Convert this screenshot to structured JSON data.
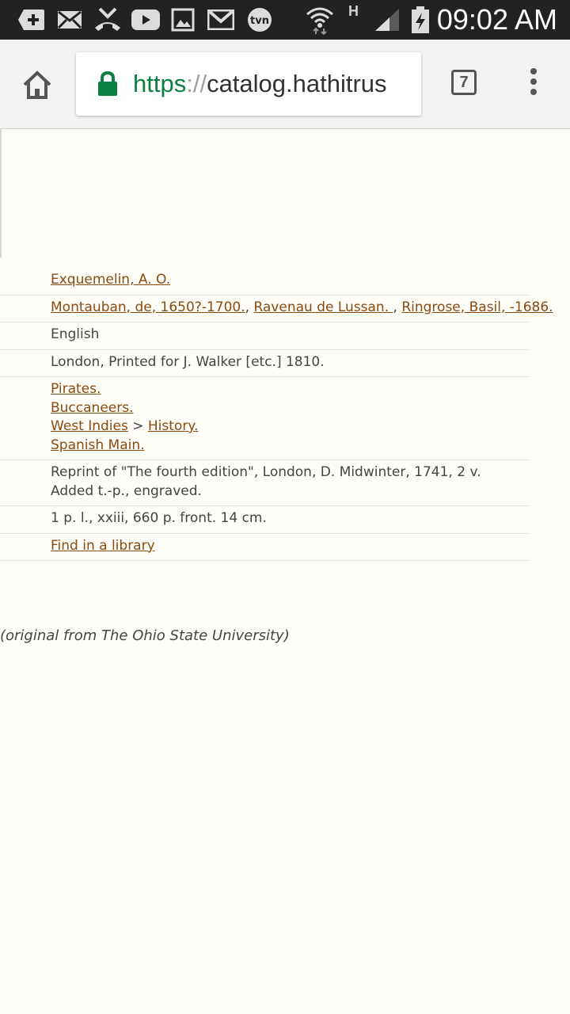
{
  "status_bar": {
    "time": "09:02 AM",
    "network_type": "H",
    "left_icons": [
      "add-icon",
      "mail-icon",
      "missed-call-icon",
      "youtube-icon",
      "gallery-icon",
      "gmail-icon",
      "tvn-icon"
    ],
    "tvn_label": "tvn",
    "right_icons": [
      "wifi-icon",
      "signal-icon",
      "battery-charging-icon"
    ]
  },
  "browser": {
    "url_scheme": "https",
    "url_sep": "://",
    "url_host": "catalog.hathitrus",
    "tab_count": "7"
  },
  "record": {
    "main_author": "Exquemelin, A. O.",
    "other_authors": [
      "Montauban, de, 1650?-1700.",
      "Ravenau de Lussan. ",
      "Ringrose, Basil, -1686."
    ],
    "author_separator": ", ",
    "language": "English",
    "published": "London, Printed for J. Walker [etc.] 1810.",
    "subjects": {
      "pirates": "Pirates.",
      "buccaneers": "Buccaneers.",
      "west_indies": "West Indies",
      "subdivision_sep": ">",
      "history": "History.",
      "spanish_main": "Spanish Main."
    },
    "notes": [
      "Reprint of \"The fourth edition\", London, D. Midwinter, 1741, 2 v.",
      "Added t.-p., engraved."
    ],
    "physical_description": "1 p. l., xxiii, 660 p. front. 14 cm.",
    "find_in_library": "Find in a library"
  },
  "footer": {
    "original_from": "(original from The Ohio State University)"
  }
}
